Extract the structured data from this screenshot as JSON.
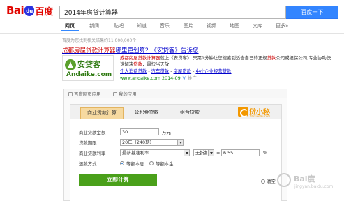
{
  "logo": {
    "text_left": "Bai",
    "paw_text": "du",
    "text_right": "百度"
  },
  "search": {
    "query": "2014年房贷计算器",
    "button": "百度一下"
  },
  "tabs": [
    "网页",
    "新闻",
    "贴吧",
    "知道",
    "音乐",
    "图片",
    "视频",
    "地图",
    "文库",
    "更多»"
  ],
  "result_count": "百度为您找到相关结果约11,000,000个",
  "ad": {
    "title_parts": [
      "成都",
      "房屋贷款计算器",
      "哪里更划算？《安贷客》告诉您"
    ],
    "logo_cn": "安贷客",
    "logo_en": "Andaike.com",
    "desc_parts": [
      "成都",
      "房屋贷款计算器",
      "就上《安贷客》 只需1分钟让您搜索到适合自己的正规",
      "贷款",
      "公司或担保公司,专业协助快速解决",
      "贷款",
      "，最快当天放"
    ],
    "links": [
      "个人消费贷款",
      "汽车贷款",
      "房屋贷款",
      "中小企业经营贷款"
    ],
    "url": "www.andaike.com 2014-09",
    "v_mark": "V",
    "ad_label": "推广"
  },
  "panel": {
    "header_left": "百度网页应用",
    "header_right": "我的应用"
  },
  "calc": {
    "tabs": [
      "商业贷款计算",
      "公积金贷款",
      "组合贷款"
    ],
    "brand_name": "贷小秘",
    "brand_sub": "daixiaomi.com",
    "fields": {
      "amount_label": "商业贷款金额",
      "amount_value": "30",
      "amount_unit": "万元",
      "term_label": "贷款期限",
      "term_value": "20年（240期）",
      "rate_label": "商业贷款利率",
      "rate_select": "最新基准利率",
      "discount_select": "无折扣",
      "rate_value": "6.55",
      "rate_eq": "=",
      "rate_unit": "%",
      "method_label": "还款方式",
      "method_1": "等额本息",
      "method_2": "等额本金"
    },
    "go_button": "立即计算",
    "clear_label": "清空"
  },
  "watermark": {
    "brand": "Bai度",
    "sub": "jingyan.baidu.com"
  }
}
